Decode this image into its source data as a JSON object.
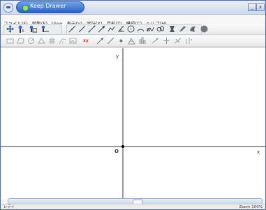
{
  "window": {
    "title": "Keep Drawer",
    "minimize_glyph": "_",
    "close_glyph": "x"
  },
  "menu": [
    "ファイル(F)",
    "編集(E)",
    "View",
    "表示(V)",
    "実行(X)",
    "変形(T)",
    "構成(C)",
    "ヘルプ(H)"
  ],
  "toolbar1": [
    "move-icon",
    "point-icon",
    "point-on-object-icon",
    "intersection-icon",
    "line-icon",
    "segment-icon",
    "ray-icon",
    "vector-icon",
    "polyline-icon",
    "angle-icon",
    "circle-icon",
    "arc-icon",
    "curve-icon",
    "conic-icon",
    "delete-icon",
    "pen-icon",
    "fill-icon",
    "dot-icon"
  ],
  "toolbar2": [
    "rectangle-icon",
    "polygon-icon",
    "circle-tool-icon",
    "triangle-icon",
    "grid-icon",
    "function-icon",
    "image-icon",
    "xy-icon",
    "arrow-icon",
    "line-tool-icon",
    "point-tool-icon",
    "measure-icon",
    "histogram-icon",
    "transform-icon",
    "locus-icon",
    "transform2-icon",
    "reflect-icon"
  ],
  "xy_label": "xy",
  "axes": {
    "x_label": "x",
    "y_label": "y",
    "origin_label": "O"
  },
  "status": {
    "left": "レディ",
    "zoom": "Zoom 100%"
  },
  "colors": {
    "title_tab": "#2c63c4",
    "xy_text": "#d33"
  }
}
